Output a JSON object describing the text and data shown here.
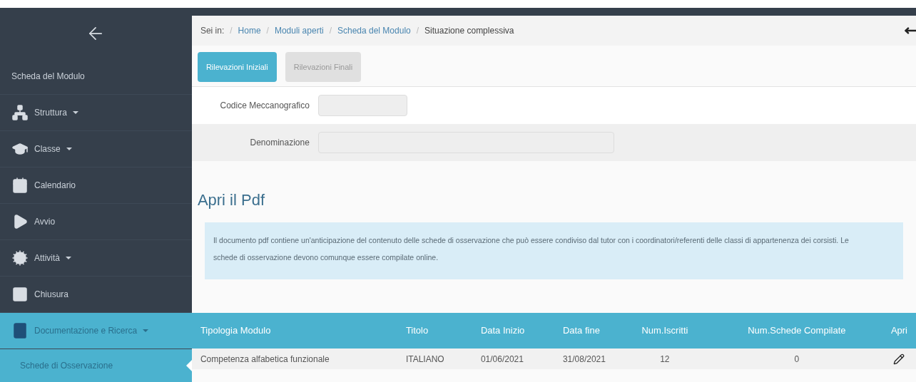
{
  "sidebar": {
    "items": [
      {
        "label": "Scheda del Modulo",
        "kind": "link",
        "selected": false
      },
      {
        "label": "Struttura",
        "kind": "dropdown",
        "selected": false
      },
      {
        "label": "Classe",
        "kind": "dropdown",
        "selected": false
      },
      {
        "label": "Calendario",
        "kind": "link",
        "selected": false
      },
      {
        "label": "Avvio",
        "kind": "link",
        "selected": false
      },
      {
        "label": "Attività",
        "kind": "dropdown",
        "selected": false
      },
      {
        "label": "Chiusura",
        "kind": "link",
        "selected": false
      },
      {
        "label": "Documentazione e Ricerca",
        "kind": "dropdown",
        "selected": true,
        "children": [
          {
            "label": "Schede di Osservazione",
            "selected": true
          }
        ]
      }
    ]
  },
  "breadcrumb": {
    "prefix": "Sei in:",
    "separator": "/",
    "items": [
      "Home",
      "Moduli aperti",
      "Scheda del Modulo"
    ],
    "current": "Situazione complessiva"
  },
  "tabs": [
    {
      "label": "Rilevazioni Iniziali",
      "selected": true
    },
    {
      "label": "Rilevazioni Finali",
      "selected": false
    }
  ],
  "form": [
    {
      "label": "Codice Meccanografico"
    },
    {
      "label": "Denominazione"
    }
  ],
  "pdf_section": {
    "title": "Apri il Pdf",
    "notice": "Il documento pdf contiene un'anticipazione del contenuto delle schede di osservazione che può essere condiviso dal tutor con i coordinatori/referenti delle classi di appartenenza dei corsisti. Le schede di osservazione devono comunque essere compilate online."
  },
  "table": {
    "columns": [
      "Tipologia Modulo",
      "Titolo",
      "Data Inizio",
      "Data fine",
      "Num.Iscritti",
      "Num.Schede Compilate",
      "Apri"
    ],
    "rows": [
      {
        "cells": [
          "Competenza alfabetica funzionale",
          "ITALIANO",
          "01/06/2021",
          "31/08/2021",
          "12",
          "0"
        ]
      }
    ]
  }
}
